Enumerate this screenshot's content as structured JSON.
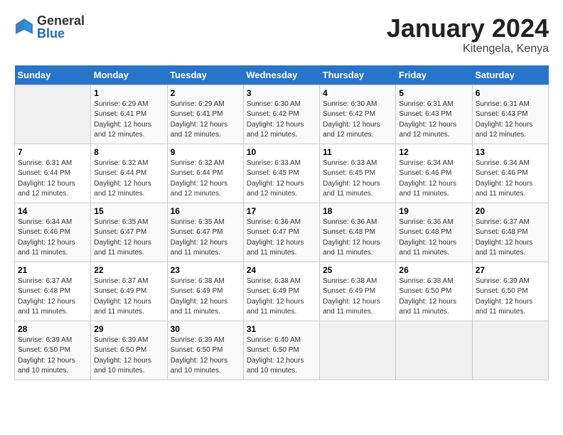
{
  "logo": {
    "general": "General",
    "blue": "Blue"
  },
  "title": "January 2024",
  "location": "Kitengela, Kenya",
  "days_header": [
    "Sunday",
    "Monday",
    "Tuesday",
    "Wednesday",
    "Thursday",
    "Friday",
    "Saturday"
  ],
  "weeks": [
    [
      {
        "num": "",
        "sunrise": "",
        "sunset": "",
        "daylight": ""
      },
      {
        "num": "1",
        "sunrise": "Sunrise: 6:29 AM",
        "sunset": "Sunset: 6:41 PM",
        "daylight": "Daylight: 12 hours and 12 minutes."
      },
      {
        "num": "2",
        "sunrise": "Sunrise: 6:29 AM",
        "sunset": "Sunset: 6:41 PM",
        "daylight": "Daylight: 12 hours and 12 minutes."
      },
      {
        "num": "3",
        "sunrise": "Sunrise: 6:30 AM",
        "sunset": "Sunset: 6:42 PM",
        "daylight": "Daylight: 12 hours and 12 minutes."
      },
      {
        "num": "4",
        "sunrise": "Sunrise: 6:30 AM",
        "sunset": "Sunset: 6:42 PM",
        "daylight": "Daylight: 12 hours and 12 minutes."
      },
      {
        "num": "5",
        "sunrise": "Sunrise: 6:31 AM",
        "sunset": "Sunset: 6:43 PM",
        "daylight": "Daylight: 12 hours and 12 minutes."
      },
      {
        "num": "6",
        "sunrise": "Sunrise: 6:31 AM",
        "sunset": "Sunset: 6:43 PM",
        "daylight": "Daylight: 12 hours and 12 minutes."
      }
    ],
    [
      {
        "num": "7",
        "sunrise": "Sunrise: 6:31 AM",
        "sunset": "Sunset: 6:44 PM",
        "daylight": "Daylight: 12 hours and 12 minutes."
      },
      {
        "num": "8",
        "sunrise": "Sunrise: 6:32 AM",
        "sunset": "Sunset: 6:44 PM",
        "daylight": "Daylight: 12 hours and 12 minutes."
      },
      {
        "num": "9",
        "sunrise": "Sunrise: 6:32 AM",
        "sunset": "Sunset: 6:44 PM",
        "daylight": "Daylight: 12 hours and 12 minutes."
      },
      {
        "num": "10",
        "sunrise": "Sunrise: 6:33 AM",
        "sunset": "Sunset: 6:45 PM",
        "daylight": "Daylight: 12 hours and 12 minutes."
      },
      {
        "num": "11",
        "sunrise": "Sunrise: 6:33 AM",
        "sunset": "Sunset: 6:45 PM",
        "daylight": "Daylight: 12 hours and 11 minutes."
      },
      {
        "num": "12",
        "sunrise": "Sunrise: 6:34 AM",
        "sunset": "Sunset: 6:46 PM",
        "daylight": "Daylight: 12 hours and 11 minutes."
      },
      {
        "num": "13",
        "sunrise": "Sunrise: 6:34 AM",
        "sunset": "Sunset: 6:46 PM",
        "daylight": "Daylight: 12 hours and 11 minutes."
      }
    ],
    [
      {
        "num": "14",
        "sunrise": "Sunrise: 6:34 AM",
        "sunset": "Sunset: 6:46 PM",
        "daylight": "Daylight: 12 hours and 11 minutes."
      },
      {
        "num": "15",
        "sunrise": "Sunrise: 6:35 AM",
        "sunset": "Sunset: 6:47 PM",
        "daylight": "Daylight: 12 hours and 11 minutes."
      },
      {
        "num": "16",
        "sunrise": "Sunrise: 6:35 AM",
        "sunset": "Sunset: 6:47 PM",
        "daylight": "Daylight: 12 hours and 11 minutes."
      },
      {
        "num": "17",
        "sunrise": "Sunrise: 6:36 AM",
        "sunset": "Sunset: 6:47 PM",
        "daylight": "Daylight: 12 hours and 11 minutes."
      },
      {
        "num": "18",
        "sunrise": "Sunrise: 6:36 AM",
        "sunset": "Sunset: 6:48 PM",
        "daylight": "Daylight: 12 hours and 11 minutes."
      },
      {
        "num": "19",
        "sunrise": "Sunrise: 6:36 AM",
        "sunset": "Sunset: 6:48 PM",
        "daylight": "Daylight: 12 hours and 11 minutes."
      },
      {
        "num": "20",
        "sunrise": "Sunrise: 6:37 AM",
        "sunset": "Sunset: 6:48 PM",
        "daylight": "Daylight: 12 hours and 11 minutes."
      }
    ],
    [
      {
        "num": "21",
        "sunrise": "Sunrise: 6:37 AM",
        "sunset": "Sunset: 6:48 PM",
        "daylight": "Daylight: 12 hours and 11 minutes."
      },
      {
        "num": "22",
        "sunrise": "Sunrise: 6:37 AM",
        "sunset": "Sunset: 6:49 PM",
        "daylight": "Daylight: 12 hours and 11 minutes."
      },
      {
        "num": "23",
        "sunrise": "Sunrise: 6:38 AM",
        "sunset": "Sunset: 6:49 PM",
        "daylight": "Daylight: 12 hours and 11 minutes."
      },
      {
        "num": "24",
        "sunrise": "Sunrise: 6:38 AM",
        "sunset": "Sunset: 6:49 PM",
        "daylight": "Daylight: 12 hours and 11 minutes."
      },
      {
        "num": "25",
        "sunrise": "Sunrise: 6:38 AM",
        "sunset": "Sunset: 6:49 PM",
        "daylight": "Daylight: 12 hours and 11 minutes."
      },
      {
        "num": "26",
        "sunrise": "Sunrise: 6:38 AM",
        "sunset": "Sunset: 6:50 PM",
        "daylight": "Daylight: 12 hours and 11 minutes."
      },
      {
        "num": "27",
        "sunrise": "Sunrise: 6:39 AM",
        "sunset": "Sunset: 6:50 PM",
        "daylight": "Daylight: 12 hours and 11 minutes."
      }
    ],
    [
      {
        "num": "28",
        "sunrise": "Sunrise: 6:39 AM",
        "sunset": "Sunset: 6:50 PM",
        "daylight": "Daylight: 12 hours and 10 minutes."
      },
      {
        "num": "29",
        "sunrise": "Sunrise: 6:39 AM",
        "sunset": "Sunset: 6:50 PM",
        "daylight": "Daylight: 12 hours and 10 minutes."
      },
      {
        "num": "30",
        "sunrise": "Sunrise: 6:39 AM",
        "sunset": "Sunset: 6:50 PM",
        "daylight": "Daylight: 12 hours and 10 minutes."
      },
      {
        "num": "31",
        "sunrise": "Sunrise: 6:40 AM",
        "sunset": "Sunset: 6:50 PM",
        "daylight": "Daylight: 12 hours and 10 minutes."
      },
      {
        "num": "",
        "sunrise": "",
        "sunset": "",
        "daylight": ""
      },
      {
        "num": "",
        "sunrise": "",
        "sunset": "",
        "daylight": ""
      },
      {
        "num": "",
        "sunrise": "",
        "sunset": "",
        "daylight": ""
      }
    ]
  ]
}
